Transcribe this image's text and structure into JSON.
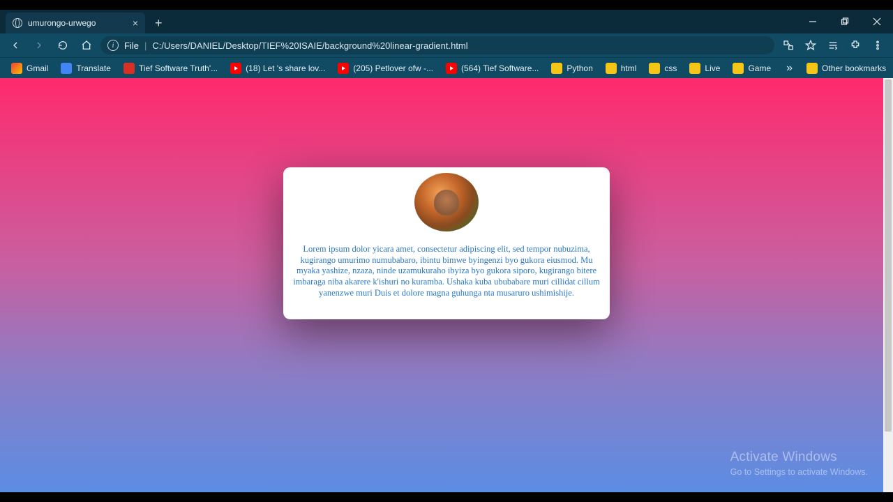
{
  "tab": {
    "title": "umurongo-urwego"
  },
  "omnibox": {
    "file_label": "File",
    "url": "C:/Users/DANIEL/Desktop/TIEF%20ISAIE/background%20linear-gradient.html"
  },
  "bookmarks": {
    "items": [
      {
        "label": "Gmail",
        "icon": "gmail"
      },
      {
        "label": "Translate",
        "icon": "translate"
      },
      {
        "label": "Tief Software Truth'...",
        "icon": "tief"
      },
      {
        "label": "(18) Let 's share lov...",
        "icon": "yt"
      },
      {
        "label": "(205) Petlover ofw -...",
        "icon": "yt"
      },
      {
        "label": "(564) Tief Software...",
        "icon": "yt"
      },
      {
        "label": "Python",
        "icon": "folder"
      },
      {
        "label": "html",
        "icon": "folder"
      },
      {
        "label": "css",
        "icon": "folder"
      },
      {
        "label": "Live",
        "icon": "folder"
      },
      {
        "label": "Game",
        "icon": "folder"
      }
    ],
    "other_label": "Other bookmarks"
  },
  "card": {
    "text": "Lorem ipsum dolor yicara amet, consectetur adipiscing elit, sed tempor nubuzima, kugirango umurimo numubabaro, ibintu bimwe byingenzi byo gukora eiusmod. Mu myaka yashize, nzaza, ninde uzamukuraho ibyiza byo gukora siporo, kugirango bitere imbaraga niba akarere k'ishuri no kuramba. Ushaka kuba ububabare muri cillidat cillum yanenzwe muri Duis et dolore magna guhunga nta musaruro ushimishije."
  },
  "watermark": {
    "title": "Activate Windows",
    "subtitle": "Go to Settings to activate Windows."
  }
}
